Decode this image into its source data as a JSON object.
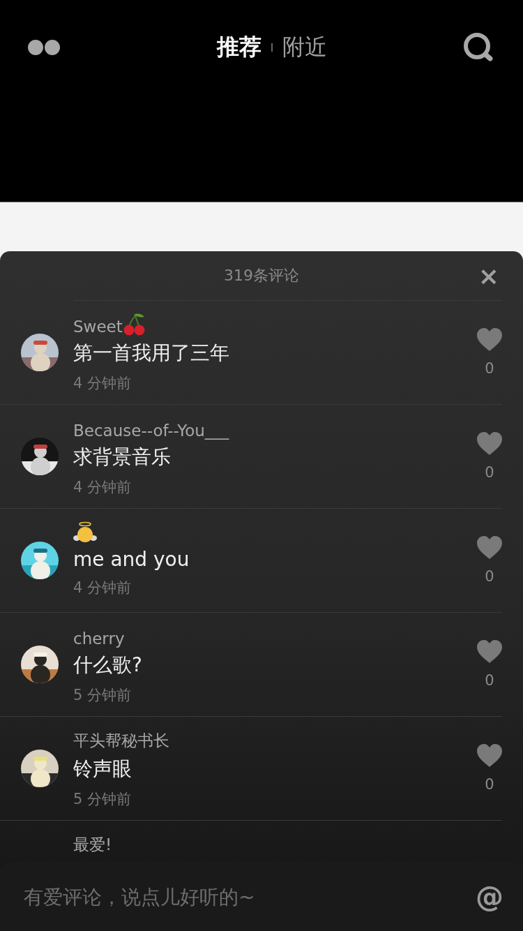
{
  "top_bar": {
    "tabs": [
      {
        "label": "推荐",
        "selected": true
      },
      {
        "label": "附近",
        "selected": false
      }
    ]
  },
  "comments_panel": {
    "title": "319条评论",
    "close": "×",
    "comments": [
      {
        "kind": "cherry",
        "user": "Sweet",
        "text": "第一首我用了三年",
        "time": "4 分钟前",
        "likes": "0",
        "liked": false
      },
      {
        "kind": "plain",
        "user": "Because--of--You___",
        "text": "求背景音乐",
        "time": "4 分钟前",
        "likes": "0",
        "liked": false
      },
      {
        "kind": "angel",
        "text": "me and you",
        "time": "4 分钟前",
        "likes": "0",
        "liked": false
      },
      {
        "kind": "plain",
        "user": "cherry",
        "text": "什么歌?",
        "time": "5 分钟前",
        "likes": "0",
        "liked": false
      },
      {
        "kind": "plain",
        "user": "平头帮秘书长",
        "text": "铃声眼",
        "time": "5 分钟前",
        "likes": "0",
        "liked": false
      },
      {
        "kind": "plain",
        "user": "最爱!"
      }
    ]
  },
  "input_bar": {
    "placeholder": "有爱评论，说点儿好听的~",
    "at": "@"
  }
}
